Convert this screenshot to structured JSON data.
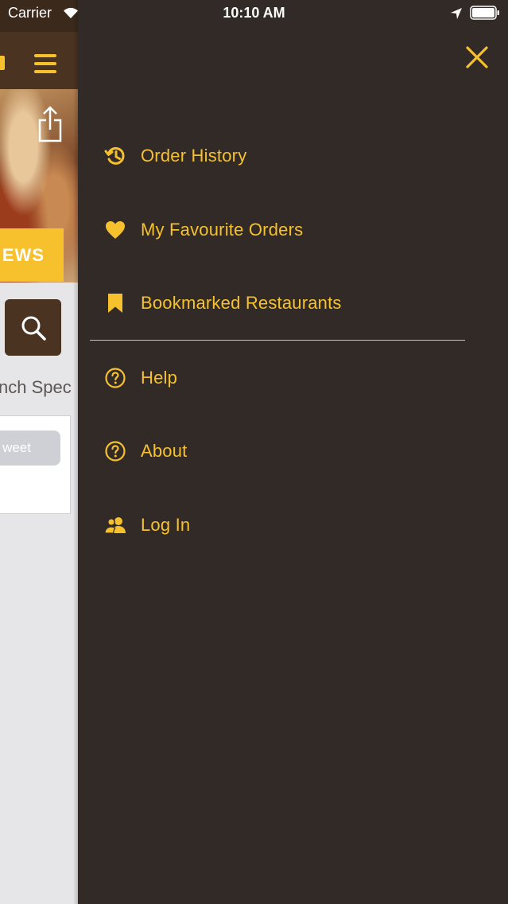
{
  "status_bar": {
    "carrier": "Carrier",
    "time": "10:10 AM"
  },
  "background_app": {
    "reviews_label": "EWS",
    "special_text": "nch Spec",
    "tweet_label": "weet"
  },
  "menu": {
    "items": [
      {
        "label": "Order History",
        "icon": "history-icon"
      },
      {
        "label": "My Favourite Orders",
        "icon": "heart-icon"
      },
      {
        "label": "Bookmarked Restaurants",
        "icon": "bookmark-icon"
      },
      {
        "label": "Help",
        "icon": "help-icon"
      },
      {
        "label": "About",
        "icon": "about-icon"
      },
      {
        "label": "Log In",
        "icon": "users-icon"
      }
    ]
  },
  "colors": {
    "accent": "#f7c12e",
    "menu_background": "#312a27",
    "header_brown": "#4a3320"
  }
}
